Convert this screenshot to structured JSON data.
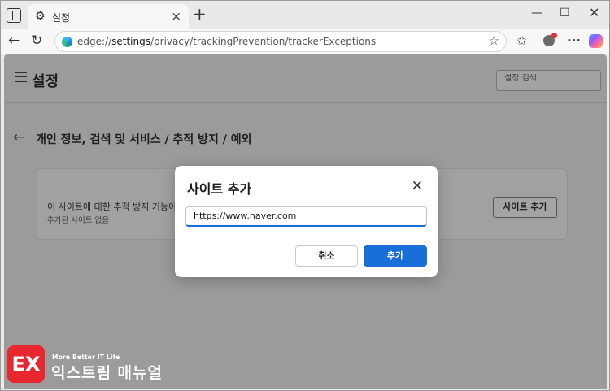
{
  "browser": {
    "tab": {
      "title": "설정",
      "favicon": "gear-icon"
    },
    "address_bar": {
      "url_prefix": "edge://",
      "url_host": "settings",
      "url_path": "/privacy/trackingPrevention/trackerExceptions"
    }
  },
  "settings": {
    "title": "설정",
    "search_placeholder": "설정 검색",
    "breadcrumb": "개인 정보, 검색 및 서비스 / 추적 방지 / 예외",
    "exceptions_card": {
      "description": "이 사이트에 대한 추적 방지 기능이",
      "empty_text": "추가된 사이트 없음",
      "add_button": "사이트 추가"
    }
  },
  "dialog": {
    "title": "사이트 추가",
    "input_value": "https://www.naver.com",
    "cancel_label": "취소",
    "add_label": "추가"
  },
  "watermark": {
    "logo_text": "EX",
    "tagline": "More Better IT Life",
    "name": "익스트림 매뉴얼"
  },
  "colors": {
    "accent": "#1a6ed8",
    "overlay": "#9b9b9b",
    "brand_red": "#e8282e"
  }
}
